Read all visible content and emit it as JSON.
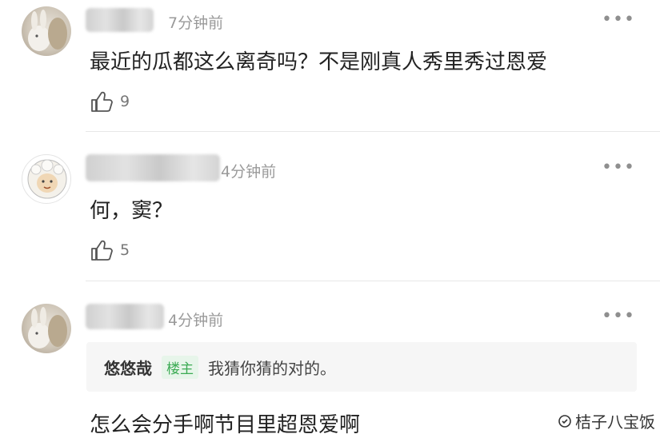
{
  "comments": [
    {
      "time": "7分钟前",
      "text": "最近的瓜都这么离奇吗？不是刚真人秀里秀过恩爱",
      "likes": "9",
      "more": "•••"
    },
    {
      "time": "4分钟前",
      "text": "何，窦？",
      "likes": "5",
      "more": "•••"
    },
    {
      "time": "4分钟前",
      "quote": {
        "name": "悠悠哉",
        "badge": "楼主",
        "text": "我猜你猜的对的。"
      },
      "text": "怎么会分手啊节目里超恩爱啊",
      "more": "•••"
    }
  ],
  "watermark": "桔子八宝饭",
  "icons": {
    "like": "thumbs-up-icon",
    "more": "more-dots-icon"
  },
  "colors": {
    "badge": "#3cab54",
    "time": "#9a9a9a"
  }
}
